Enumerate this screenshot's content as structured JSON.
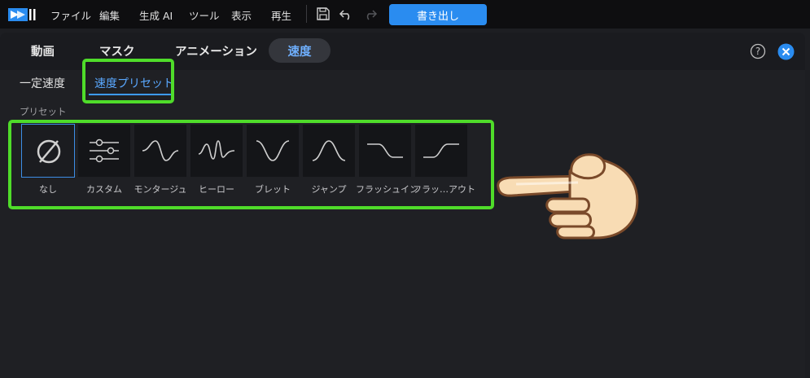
{
  "menubar": {
    "items": [
      "ファイル",
      "編集",
      "生成 AI",
      "ツール",
      "表示",
      "再生"
    ],
    "export_label": "書き出し"
  },
  "tabs": {
    "items": [
      "動画",
      "マスク",
      "アニメーション"
    ],
    "active": "速度"
  },
  "subtabs": {
    "constant": "一定速度",
    "preset": "速度プリセット"
  },
  "presets": {
    "section_label": "プリセット",
    "items": [
      "なし",
      "カスタム",
      "モンタージュ",
      "ヒーロー",
      "ブレット",
      "ジャンプ",
      "フラッシュイン",
      "フラッ…アウト"
    ]
  },
  "colors": {
    "accent": "#2a8cf0",
    "highlight": "#4fdc2a",
    "active_tab_text": "#6fb0ff"
  }
}
